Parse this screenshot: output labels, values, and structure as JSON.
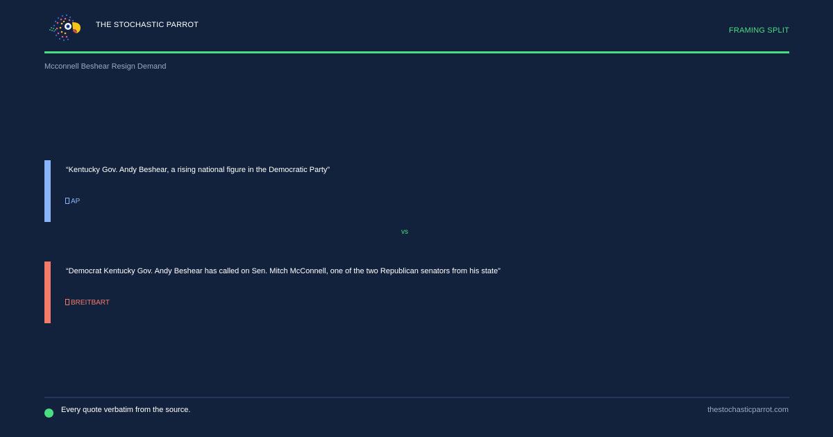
{
  "header": {
    "brand": "THE STOCHASTIC PARROT",
    "tagline": "FRAMING SPLIT",
    "logo_icon": "parrot-logo-icon"
  },
  "topic": "Mcconnell Beshear Resign Demand",
  "quotes": [
    {
      "text": "“Kentucky Gov. Andy Beshear, a rising national figure in the Democratic Party”",
      "source": "AP",
      "color": "#8ab4f8"
    },
    {
      "text": "“Democrat Kentucky Gov. Andy Beshear has called on Sen. Mitch McConnell, one of the two Republican senators from his state”",
      "source": "BREITBART",
      "color": "#f47a6a"
    }
  ],
  "vs_label": "vs",
  "footer": {
    "note": "Every quote verbatim from the source.",
    "url": "thestochasticparrot.com"
  },
  "colors": {
    "background": "#12223d",
    "accent": "#4ade80",
    "muted": "#9aa7bd"
  }
}
